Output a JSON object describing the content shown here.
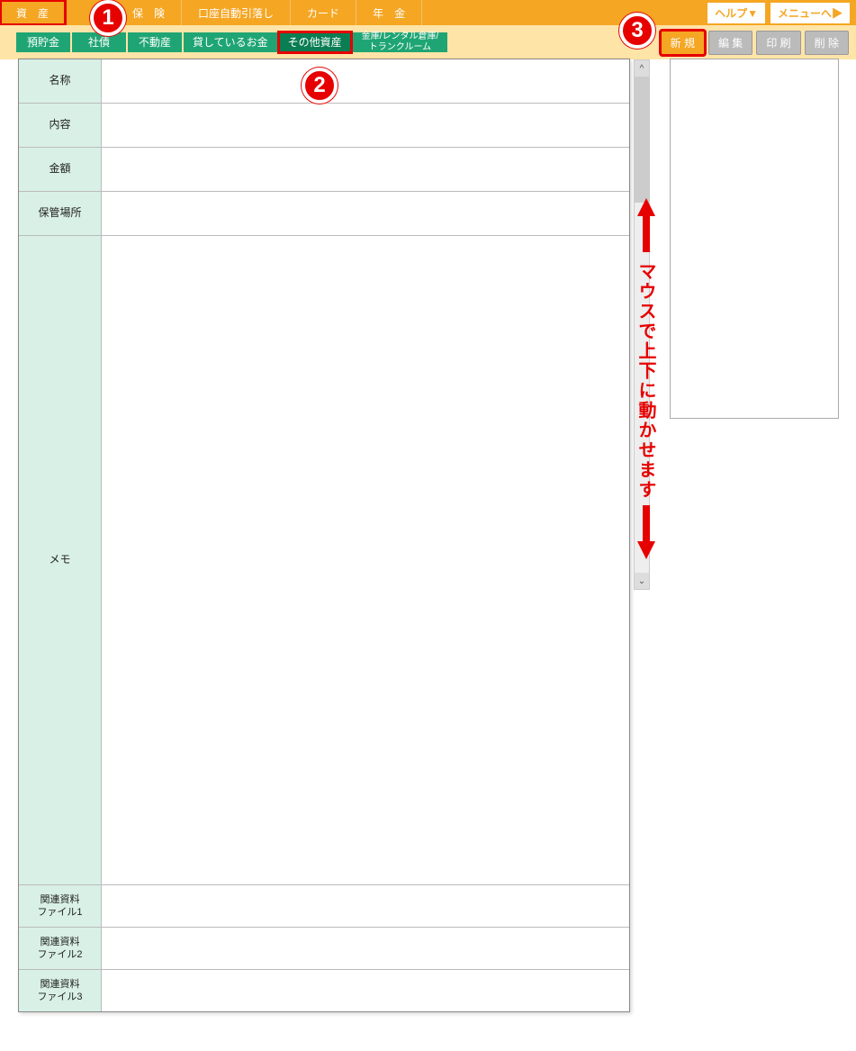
{
  "topnav": {
    "items": [
      "資　産",
      "保　険",
      "口座自動引落し",
      "カード",
      "年　金"
    ],
    "active_index": 0,
    "help_label": "ヘルプ▼",
    "menu_label": "メニューへ▶"
  },
  "subtabs": {
    "items": [
      "預貯金",
      "社債",
      "不動産",
      "貸しているお金",
      "その他資産",
      "金庫/レンタル倉庫/\nトランクルーム"
    ],
    "active_index": 4
  },
  "actions": {
    "new": "新 規",
    "edit": "編 集",
    "print": "印 刷",
    "delete": "削 除"
  },
  "form": {
    "rows": [
      {
        "label": "名称",
        "value": ""
      },
      {
        "label": "内容",
        "value": ""
      },
      {
        "label": "金額",
        "value": ""
      },
      {
        "label": "保管場所",
        "value": ""
      },
      {
        "label": "メモ",
        "value": "",
        "tall": true
      },
      {
        "label": "関連資料\nファイル1",
        "value": "",
        "short": true,
        "multiline": true
      },
      {
        "label": "関連資料\nファイル2",
        "value": "",
        "short": true,
        "multiline": true
      },
      {
        "label": "関連資料\nファイル3",
        "value": "",
        "short": true,
        "multiline": true
      }
    ]
  },
  "badges": {
    "b1": "1",
    "b2": "2",
    "b3": "3"
  },
  "scroll_hint": "マウスで上下に動かせます"
}
